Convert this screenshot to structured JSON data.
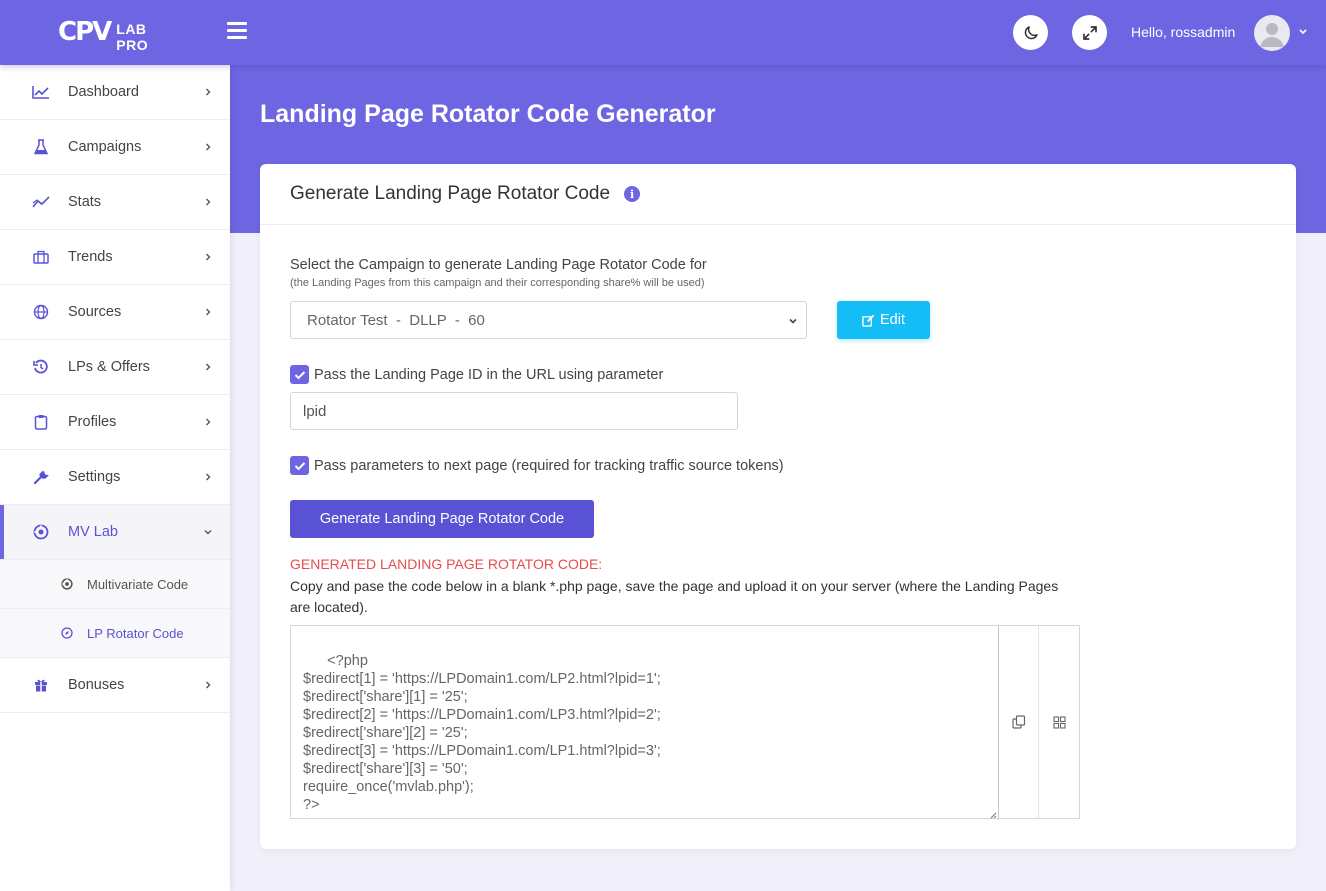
{
  "header": {
    "logo_mark": "CPV",
    "logo_text": "LAB PRO",
    "greeting": "Hello, rossadmin"
  },
  "sidebar": {
    "items": [
      {
        "label": "Dashboard",
        "icon": "chart-line-icon"
      },
      {
        "label": "Campaigns",
        "icon": "flask-icon"
      },
      {
        "label": "Stats",
        "icon": "stats-icon"
      },
      {
        "label": "Trends",
        "icon": "briefcase-icon"
      },
      {
        "label": "Sources",
        "icon": "globe-icon"
      },
      {
        "label": "LPs & Offers",
        "icon": "history-icon"
      },
      {
        "label": "Profiles",
        "icon": "clipboard-icon"
      },
      {
        "label": "Settings",
        "icon": "wrench-icon"
      },
      {
        "label": "MV Lab",
        "icon": "mvlab-icon",
        "active": true
      },
      {
        "label": "Bonuses",
        "icon": "gift-icon"
      }
    ],
    "sub_items": [
      {
        "label": "Multivariate Code",
        "icon": "mvlab-small-icon"
      },
      {
        "label": "LP Rotator Code",
        "icon": "compass-icon",
        "active": true
      }
    ]
  },
  "page": {
    "title": "Landing Page Rotator Code Generator"
  },
  "card": {
    "title": "Generate Landing Page Rotator Code",
    "select_label": "Select the Campaign to generate Landing Page Rotator Code for",
    "select_hint": "(the Landing Pages from this campaign and their corresponding share% will be used)",
    "select_value": "Rotator Test  -  DLLP  -  60",
    "edit_label": "Edit",
    "pass_lpid_label": "Pass the Landing Page ID in the URL using parameter",
    "pass_lpid_checked": true,
    "lpid_param_value": "lpid",
    "pass_params_label": "Pass parameters to next page (required for tracking traffic source tokens)",
    "pass_params_checked": true,
    "generate_label": "Generate Landing Page Rotator Code",
    "generated_heading": "GENERATED LANDING PAGE ROTATOR CODE:",
    "generated_desc": "Copy and pase the code below in a blank *.php page, save the page and upload it on your server (where the Landing Pages are located).",
    "code": "<?php\n$redirect[1] = 'https://LPDomain1.com/LP2.html?lpid=1';\n$redirect['share'][1] = '25';\n$redirect[2] = 'https://LPDomain1.com/LP3.html?lpid=2';\n$redirect['share'][2] = '25';\n$redirect[3] = 'https://LPDomain1.com/LP1.html?lpid=3';\n$redirect['share'][3] = '50';\nrequire_once('mvlab.php');\n?>"
  },
  "colors": {
    "primary": "#6e65e3",
    "button_dark": "#5a52d5",
    "edit_button": "#14bdf5",
    "heading_red": "#e84c4c"
  }
}
